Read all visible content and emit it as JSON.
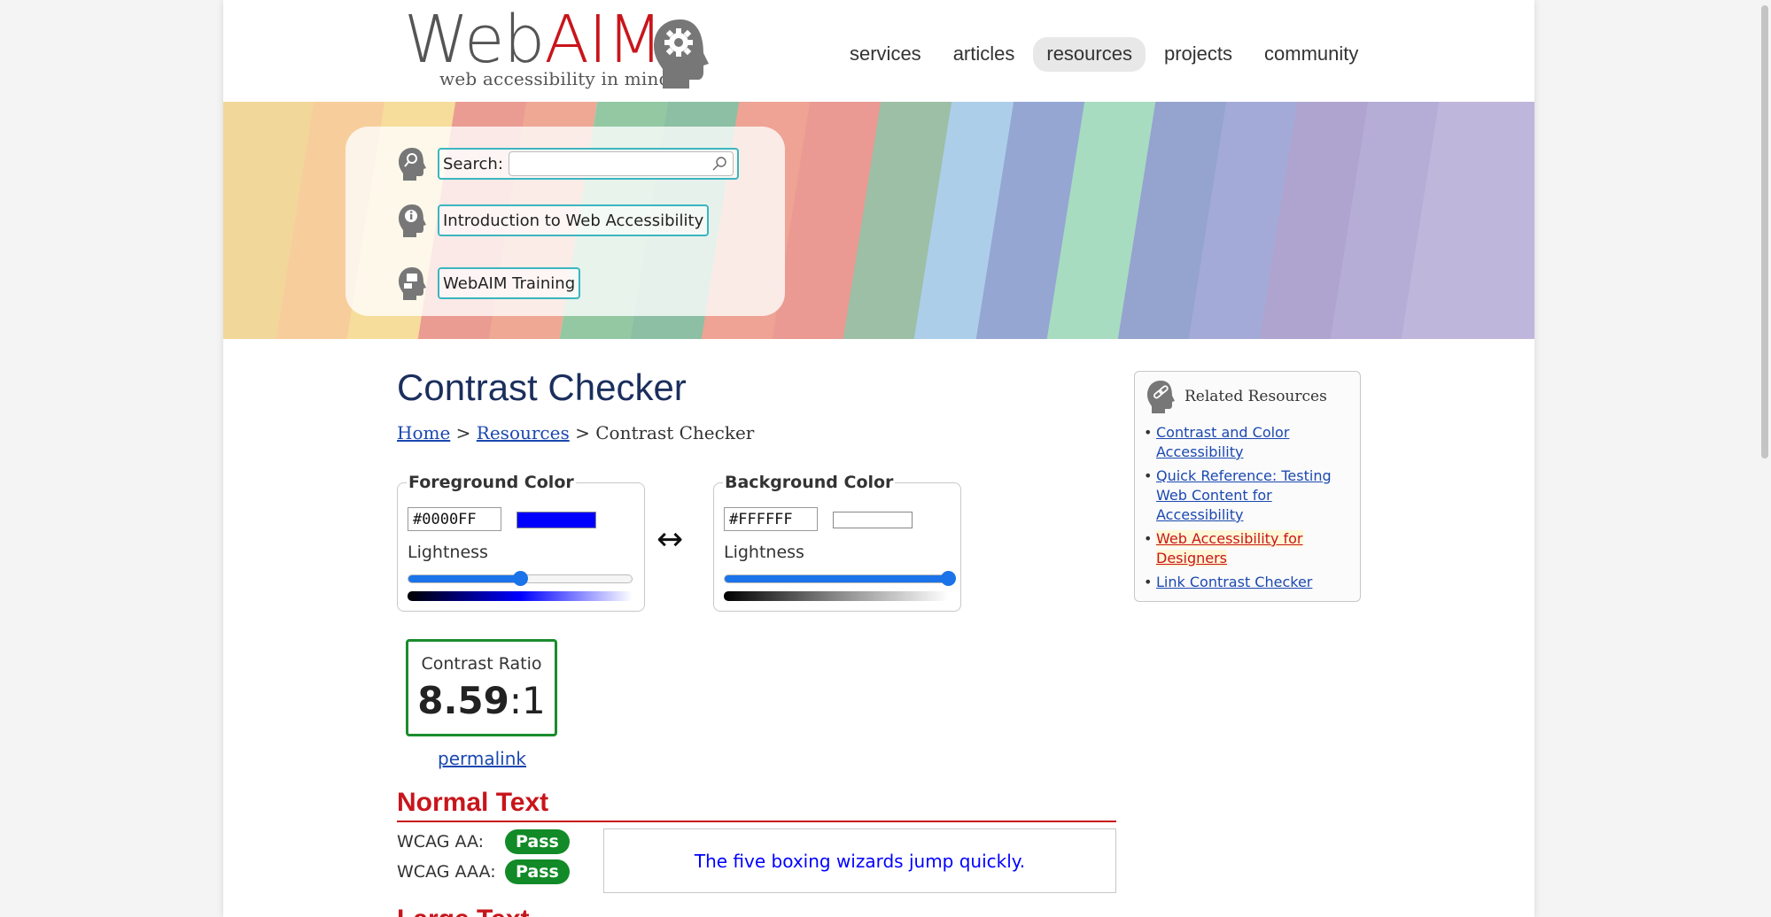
{
  "header": {
    "logo_web": "Web",
    "logo_aim": "AIM",
    "logo_tagline": "web accessibility in mind",
    "nav": [
      {
        "label": "services"
      },
      {
        "label": "articles"
      },
      {
        "label": "resources",
        "active": true
      },
      {
        "label": "projects"
      },
      {
        "label": "community"
      }
    ]
  },
  "banner": {
    "search_label": "Search:",
    "search_placeholder": "",
    "intro_link": "Introduction to Web Accessibility",
    "training_link": "WebAIM Training"
  },
  "main": {
    "title": "Contrast Checker",
    "breadcrumb": {
      "home": "Home",
      "sep1": ">",
      "resources": "Resources",
      "sep2": ">",
      "current": "Contrast Checker"
    },
    "foreground": {
      "legend": "Foreground Color",
      "hex": "#0000FF",
      "swatch_color": "#0000ff",
      "lightness_label": "Lightness",
      "lightness_value": 0.5
    },
    "swap_icon": "↔",
    "background": {
      "legend": "Background Color",
      "hex": "#FFFFFF",
      "swatch_color": "#ffffff",
      "lightness_label": "Lightness",
      "lightness_value": 1.0
    },
    "contrast": {
      "label": "Contrast Ratio",
      "ratio": "8.59",
      "suffix": ":1",
      "permalink": "permalink"
    },
    "normal_text": {
      "heading": "Normal Text",
      "aa_label": "WCAG AA:",
      "aa_result": "Pass",
      "aaa_label": "WCAG AAA:",
      "aaa_result": "Pass",
      "sample": "The five boxing wizards jump quickly."
    },
    "large_text": {
      "heading": "Large Text"
    }
  },
  "sidebar": {
    "title": "Related Resources",
    "links": [
      {
        "label": "Contrast and Color Accessibility"
      },
      {
        "label": "Quick Reference: Testing Web Content for Accessibility"
      },
      {
        "label": "Web Accessibility for Designers",
        "highlighted": true
      },
      {
        "label": "Link Contrast Checker"
      }
    ]
  },
  "colors": {
    "brand_red": "#c8151b",
    "title_navy": "#1b2f5e",
    "link_blue": "#1b48b0",
    "pass_green": "#128a28",
    "slider_blue": "#1a73e8"
  }
}
